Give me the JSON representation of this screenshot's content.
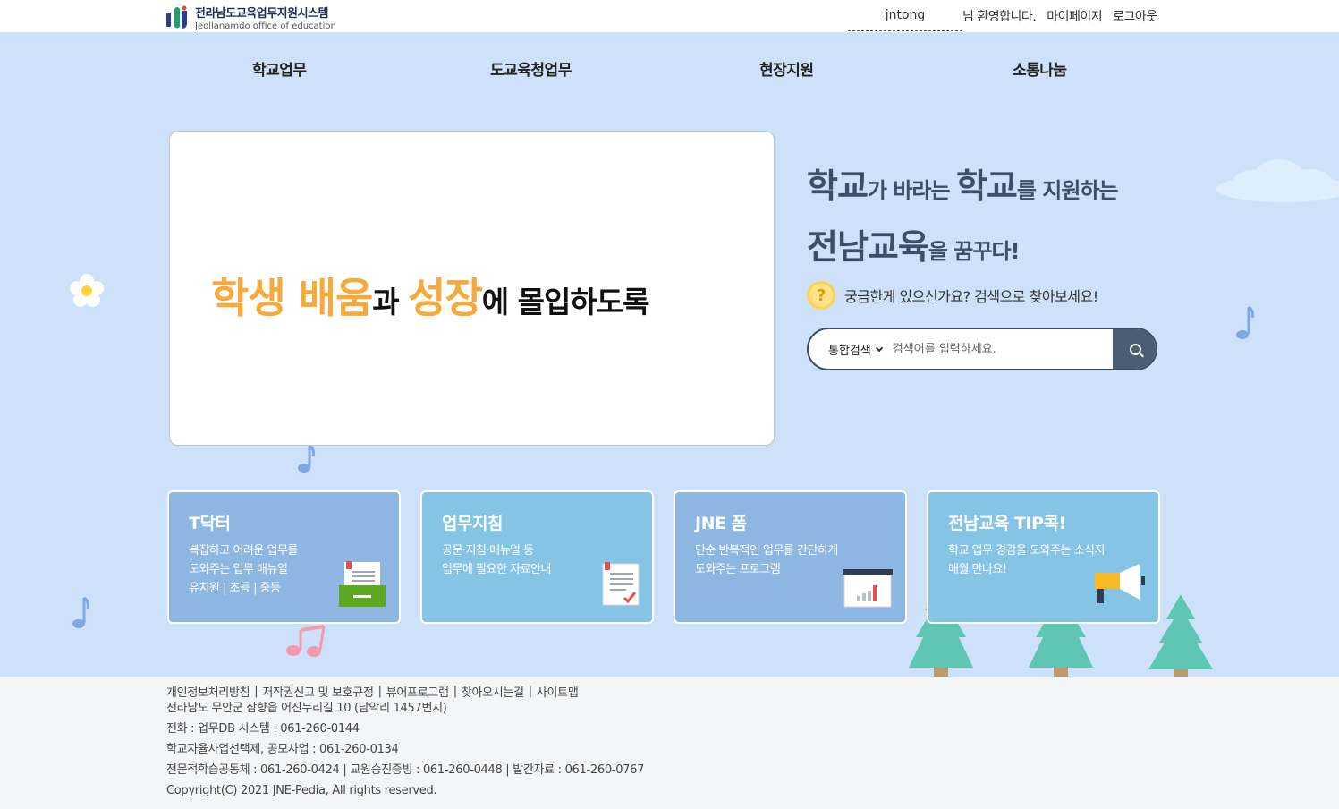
{
  "header": {
    "logo_title": "전라남도교육업무지원시스템",
    "logo_subtitle": "Jeollanamdo office of education",
    "username": "jntong",
    "welcome": "님 환영합니다.",
    "mypage": "마이페이지",
    "logout": "로그아웃"
  },
  "nav": {
    "items": [
      "학교업무",
      "도교육청업무",
      "현장지원",
      "소통나눔"
    ]
  },
  "banner": {
    "part1": "학생 배움",
    "part2": "과 ",
    "part3": "성장",
    "part4": "에 몰입하도록"
  },
  "slogan": {
    "w1": "학교",
    "w2": "가 바라는 ",
    "w3": "학교",
    "w4": "를 지원하는",
    "w5": "전남교육",
    "w6": "을 꿈꾸다!"
  },
  "question": {
    "icon": "question-icon",
    "text": "궁금한게 있으신가요? 검색으로 찾아보세요!"
  },
  "search": {
    "select_value": "통합검색",
    "placeholder": "검색어를 입력하세요."
  },
  "cards": [
    {
      "title": "T닥터",
      "lines": [
        "복잡하고 어려운 업무를",
        "도와주는 업무 매뉴얼",
        "유치원 | 초등 | 중등"
      ],
      "bg": "#8db6e3",
      "icon": "manual-box-icon"
    },
    {
      "title": "업무지침",
      "lines": [
        "공문·지침·매뉴얼 등",
        "업무에 필요한 자료안내"
      ],
      "bg": "#86c4e6",
      "icon": "document-check-icon"
    },
    {
      "title": "JNE 폼",
      "lines": [
        "단순 반복적인 업무를 간단하게",
        "도와주는 프로그램"
      ],
      "bg": "#8db6e3",
      "icon": "chart-board-icon"
    },
    {
      "title": "전남교육 TIP콕!",
      "lines": [
        "학교 업무 경감을 도와주는 소식지",
        "매월 만나요!"
      ],
      "bg": "#86c4e6",
      "icon": "megaphone-icon"
    }
  ],
  "footer": {
    "links": [
      "개인정보처리방침",
      "저작권신고 및 보호규정",
      "뷰어프로그램",
      "찾아오시는길",
      "사이트맵"
    ],
    "address": "전라남도 무안군 삼향읍 어진누리길 10 (남악리 1457번지)",
    "phone1": "전화 : 업무DB 시스템 : 061-260-0144",
    "phone2": "학교자율사업선택제, 공모사업 : 061-260-0134",
    "phone3": "전문적학습공동체 : 061-260-0424 | 교원승진증빙 : 061-260-0448 | 발간자료 : 061-260-0767",
    "copyright": "Copyright(C) 2021 JNE-Pedia, All rights reserved."
  },
  "colors": {
    "main_bg": "#cde2fa",
    "accent_orange": "#f7a93a",
    "navy": "#3b4e68"
  }
}
